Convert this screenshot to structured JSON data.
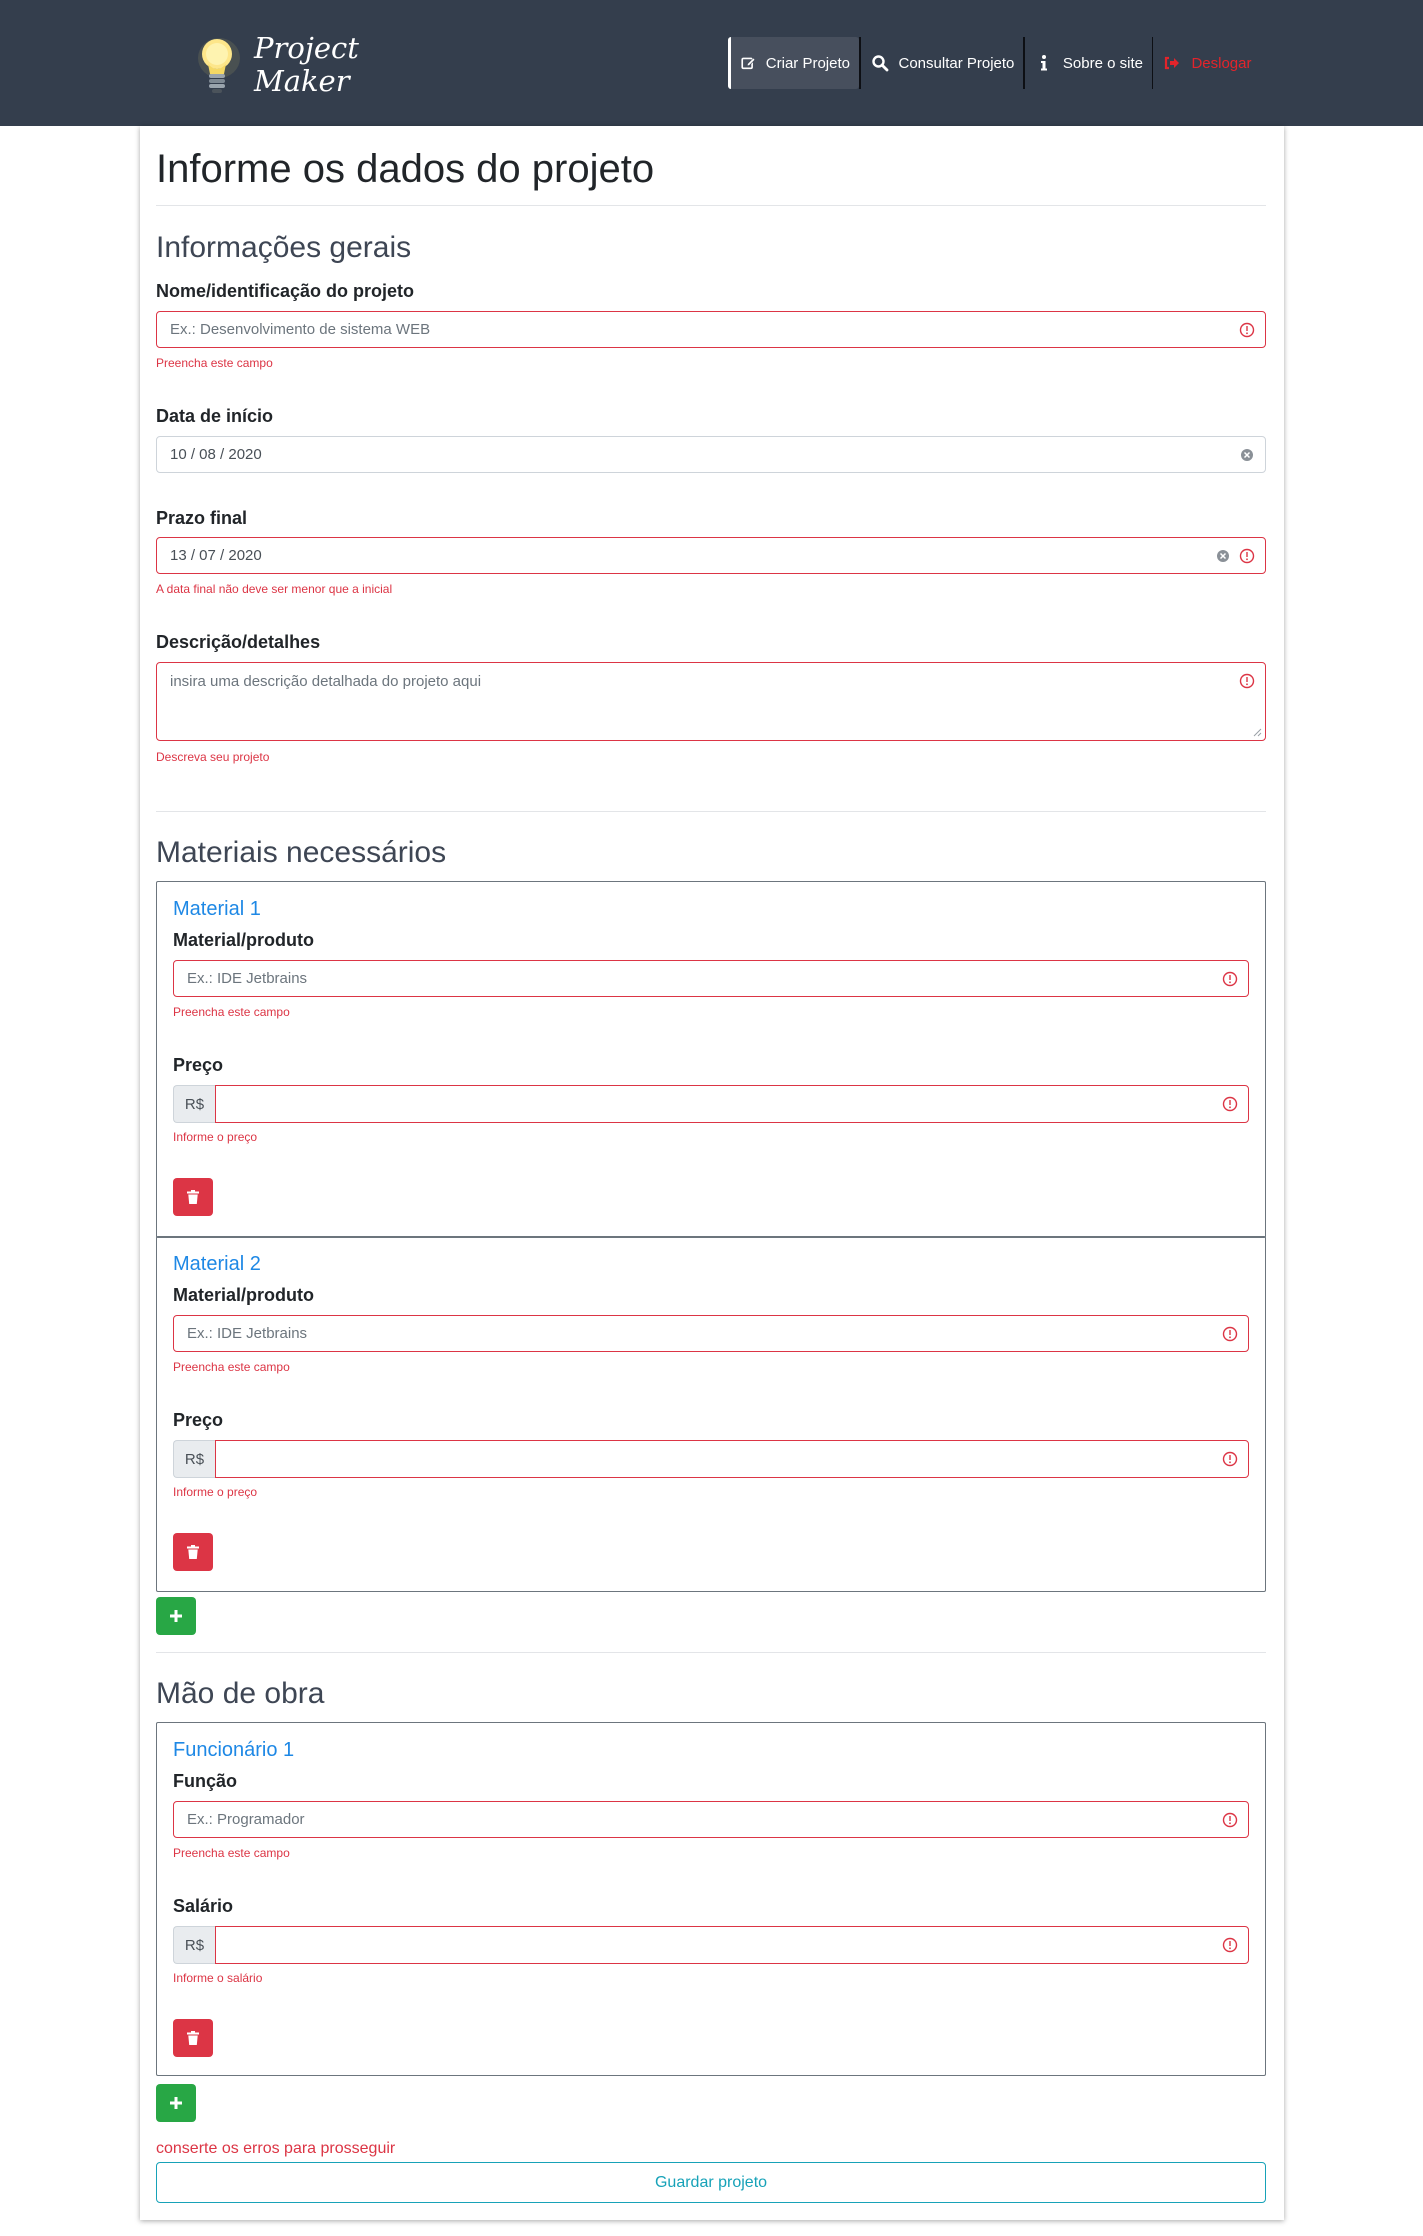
{
  "brand": {
    "line1": "Project",
    "line2": "Maker",
    "icon": "lightbulb-icon"
  },
  "nav": {
    "items": [
      {
        "label": "Criar Projeto",
        "icon": "edit-icon",
        "active": true
      },
      {
        "label": "Consultar Projeto",
        "icon": "search-icon"
      },
      {
        "label": "Sobre o site",
        "icon": "info-icon"
      },
      {
        "label": "Deslogar",
        "icon": "logout-icon",
        "color": "#e3242b"
      }
    ]
  },
  "page": {
    "title": "Informe os dados do projeto"
  },
  "general": {
    "title": "Informações gerais",
    "name": {
      "label": "Nome/identificação do projeto",
      "placeholder": "Ex.: Desenvolvimento de sistema WEB",
      "error": "Preencha este campo"
    },
    "start": {
      "label": "Data de início",
      "value": "10 / 08 / 2020"
    },
    "deadline": {
      "label": "Prazo final",
      "value": "13 / 07 / 2020",
      "error": "A data final não deve ser menor que a inicial"
    },
    "description": {
      "label": "Descrição/detalhes",
      "placeholder": "insira uma descrição detalhada do projeto aqui",
      "error": "Descreva seu projeto"
    }
  },
  "materials": {
    "title": "Materiais necessários",
    "items": [
      {
        "title": "Material 1",
        "product_label": "Material/produto",
        "product_placeholder": "Ex.: IDE Jetbrains",
        "product_error": "Preencha este campo",
        "price_label": "Preço",
        "currency": "R$",
        "price_error": "Informe o preço"
      },
      {
        "title": "Material 2",
        "product_label": "Material/produto",
        "product_placeholder": "Ex.: IDE Jetbrains",
        "product_error": "Preencha este campo",
        "price_label": "Preço",
        "currency": "R$",
        "price_error": "Informe o preço"
      }
    ]
  },
  "labor": {
    "title": "Mão de obra",
    "items": [
      {
        "title": "Funcionário 1",
        "role_label": "Função",
        "role_placeholder": "Ex.: Programador",
        "role_error": "Preencha este campo",
        "salary_label": "Salário",
        "currency": "R$",
        "salary_error": "Informe o salário"
      }
    ]
  },
  "footer": {
    "error": "conserte os erros para prosseguir",
    "save_label": "Guardar projeto"
  },
  "colors": {
    "navbar": "#343e4d",
    "error": "#dc3545",
    "success": "#28a745",
    "info": "#17a2b8",
    "link": "#1e88e5"
  }
}
